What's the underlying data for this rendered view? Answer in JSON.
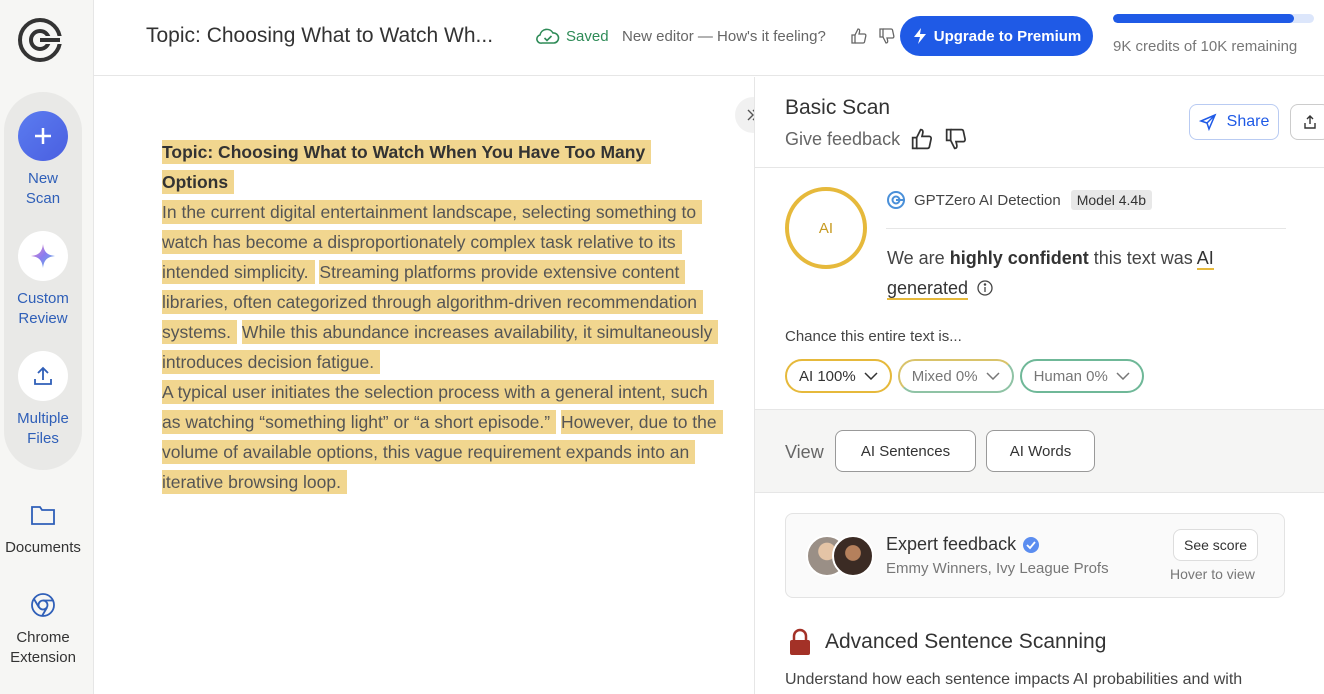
{
  "sidebar": {
    "items": [
      {
        "label_line1": "New",
        "label_line2": "Scan",
        "icon": "plus-icon"
      },
      {
        "label_line1": "Custom",
        "label_line2": "Review",
        "icon": "sparkle-icon"
      },
      {
        "label_line1": "Multiple",
        "label_line2": "Files",
        "icon": "upload-icon"
      }
    ],
    "documents_label": "Documents",
    "chrome_line1": "Chrome",
    "chrome_line2": "Extension"
  },
  "header": {
    "doc_title": "Topic: Choosing What to Watch Wh...",
    "saved": "Saved",
    "feedback_question": "New editor — How's it feeling?",
    "upgrade_label": "Upgrade to Premium",
    "credits_text": "9K credits of 10K remaining",
    "credits_remaining_fraction": 0.9,
    "accent_color": "#1f5ae6"
  },
  "document": {
    "title": "Topic: Choosing What to Watch When You Have Too Many Options",
    "p1_s1": "In the current digital entertainment landscape, selecting something to watch has become a disproportionately complex task relative to its intended simplicity.",
    "p1_s2": "Streaming platforms provide extensive content libraries, often categorized through algorithm-driven recommendation systems.",
    "p1_s3": "While this abundance increases availability, it simultaneously introduces decision fatigue.",
    "p2_s1": "A typical user initiates the selection process with a general intent, such as watching “something light” or “a short episode.”",
    "p2_s2": "However, due to the volume of available options, this vague requirement expands into an iterative browsing loop.",
    "highlight_color": "#f1d68f"
  },
  "panel": {
    "scan_title": "Basic Scan",
    "give_feedback": "Give feedback",
    "share_label": "Share",
    "ai_ring_label": "AI",
    "detector_name": "GPTZero AI Detection",
    "model_badge": "Model 4.4b",
    "confidence_prefix": "We are",
    "confidence_strong": "highly confident",
    "confidence_mid": "this text was",
    "confidence_result": "AI generated",
    "chance_label": "Chance this entire text is...",
    "pills": [
      {
        "label": "AI 100%"
      },
      {
        "label": "Mixed 0%"
      },
      {
        "label": "Human 0%"
      }
    ],
    "view_label": "View",
    "view_buttons": [
      "AI Sentences",
      "AI Words"
    ],
    "expert_title": "Expert feedback",
    "expert_sub": "Emmy Winners, Ivy League Profs",
    "see_score": "See score",
    "hover_view": "Hover to view",
    "advanced_title": "Advanced Sentence Scanning",
    "advanced_text": "Understand how each sentence impacts AI probabilities and with"
  }
}
